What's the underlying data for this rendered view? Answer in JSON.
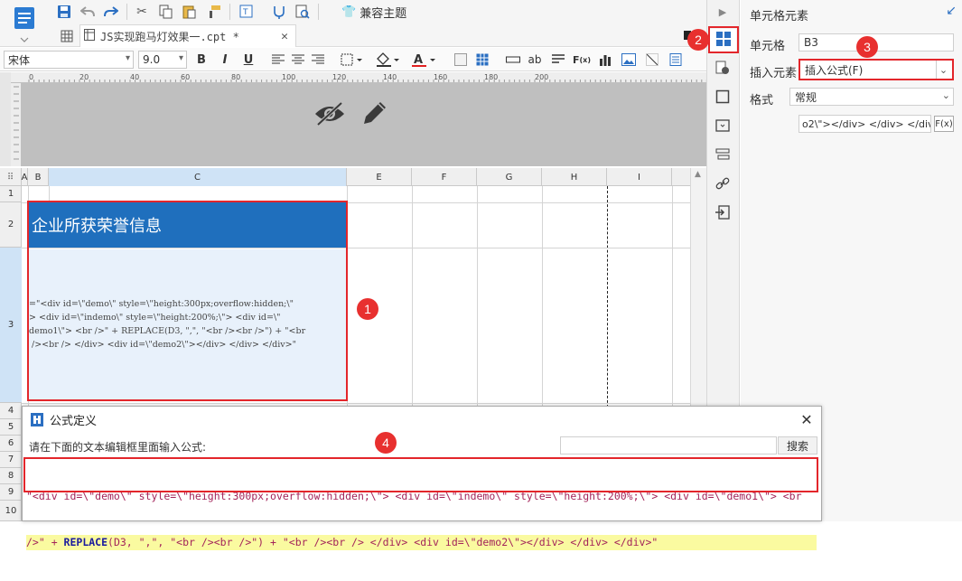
{
  "toolbar": {
    "theme_label": "兼容主题",
    "file_tab": "JS实现跑马灯效果一.cpt *",
    "font_name": "宋体",
    "font_size": "9.0",
    "bold": "B",
    "italic": "I",
    "underline": "U"
  },
  "sheet": {
    "columns": [
      "A",
      "B",
      "C",
      "E",
      "F",
      "G",
      "H",
      "I"
    ],
    "rows": [
      "1",
      "2",
      "3",
      "4",
      "5",
      "6",
      "7",
      "8",
      "9",
      "10"
    ],
    "c2_text": "企业所获荣誉信息",
    "c3_text": "=\"<div id=\\\"demo\\\" style=\\\"height:300px;overflow:hidden;\\\"\n> <div id=\\\"indemo\\\" style=\\\"height:200%;\\\"> <div id=\\\"\ndemo1\\\"> <br />\" + REPLACE(D3, \",\", \"<br /><br />\") + \"<br\n /><br /> </div> <div id=\\\"demo2\\\"></div> </div> </div>\"",
    "ruler_ticks": [
      "0",
      "20",
      "40",
      "60",
      "80",
      "100",
      "120",
      "140",
      "160",
      "180",
      "200"
    ]
  },
  "panel": {
    "title": "单元格元素",
    "cell_label": "单元格",
    "cell_value": "B3",
    "insert_label": "插入元素",
    "insert_value": "插入公式(F)",
    "style_label": "格式",
    "style_value": "常规",
    "formula_preview": "o2\\\"></div> </div> </div>\"",
    "fx_label": "F(x)"
  },
  "dialog": {
    "title": "公式定义",
    "prompt": "请在下面的文本编辑框里面输入公式:",
    "search_placeholder": "",
    "search_button": "搜索",
    "line1": "\"<div id=\\\"demo\\\" style=\\\"height:300px;overflow:hidden;\\\"> <div id=\\\"indemo\\\" style=\\\"height:200%;\\\"> <div id=\\\"demo1\\\"> <br",
    "line2_a": "/>\" + ",
    "line2_kw": "REPLACE",
    "line2_b": "(D3, \",\", \"<br /><br />\") + \"<br /><br /> </div> <div id=\\\"demo2\\\"></div> </div> </div>\""
  },
  "badges": [
    "1",
    "2",
    "3",
    "4"
  ],
  "colors": {
    "accent": "#1f6fbd",
    "highlight": "#e3262b",
    "code_line": "#fafaa0"
  }
}
